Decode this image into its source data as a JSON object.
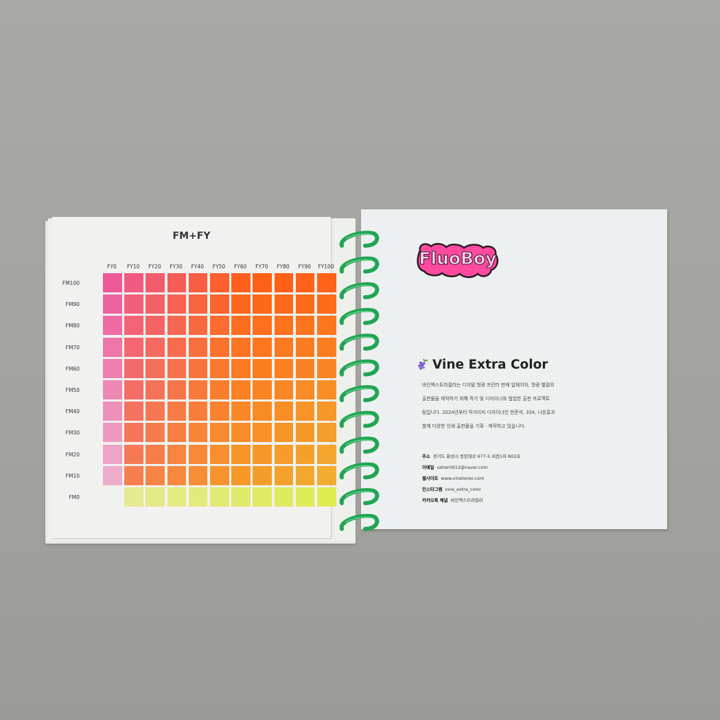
{
  "left_page": {
    "chart_title": "FM+FY",
    "columns": [
      "FY0",
      "FY10",
      "FY20",
      "FY30",
      "FY40",
      "FY50",
      "FY60",
      "FY70",
      "FY80",
      "FY90",
      "FY100"
    ],
    "rows": [
      "FM100",
      "FM90",
      "FM80",
      "FM70",
      "FM60",
      "FM50",
      "FM40",
      "FM30",
      "FM20",
      "FM10",
      "FM0"
    ]
  },
  "colors": {
    "magenta": "#ee5a98",
    "orange_red": "#ff5a17",
    "yellow": "#ddec50",
    "paper": "#f1f2ef",
    "spiral": "#22a553",
    "logo_pink": "#ff4aa0"
  },
  "right_page": {
    "logo_text": "FluoBoy",
    "brand_icon": "grape-icon",
    "brand_title": "Vine Extra Color",
    "description": [
      "바인엑스트라컬러는 디지털 형광 프린터 판매 업체이자, 형광 별컬의",
      "출판물을 제작하기 위해 작가 및 디자이너와 협업한 출판 프로젝트",
      "팀입니다. 2024년부터 작가이자 디자이너인 한준석, 334, 나운흥과",
      "함께 다양한 인쇄 출판물을 기획 · 제작하고 있습니다."
    ],
    "info": [
      {
        "label": "주소",
        "value": "경기도 화성시 동탄대로 677-5 비전1차 B02호"
      },
      {
        "label": "이메일",
        "value": "usher0612@naver.com"
      },
      {
        "label": "웹사이트",
        "value": "www.vinetoner.com"
      },
      {
        "label": "인스타그램",
        "value": "vine_extra_color"
      },
      {
        "label": "카카오톡 채널",
        "value": "바인엑스트라컬러"
      }
    ]
  }
}
